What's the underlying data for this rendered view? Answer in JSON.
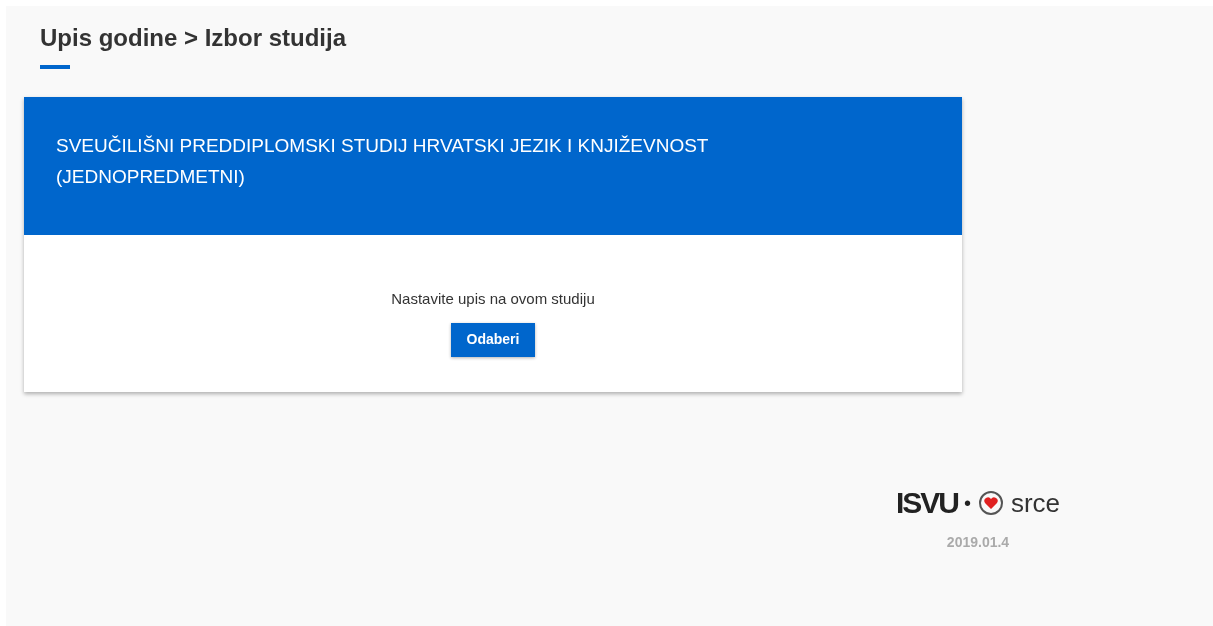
{
  "page_title": "Upis godine > Izbor studija",
  "study_card": {
    "title": "SVEUČILIŠNI PREDDIPLOMSKI STUDIJ HRVATSKI JEZIK I KNJIŽEVNOST (JEDNOPREDMETNI)",
    "prompt": "Nastavite upis na ovom studiju",
    "button": "Odaberi"
  },
  "footer": {
    "logo_left": "ISVU",
    "separator": "•",
    "logo_right": "srce",
    "version": "2019.01.4"
  }
}
